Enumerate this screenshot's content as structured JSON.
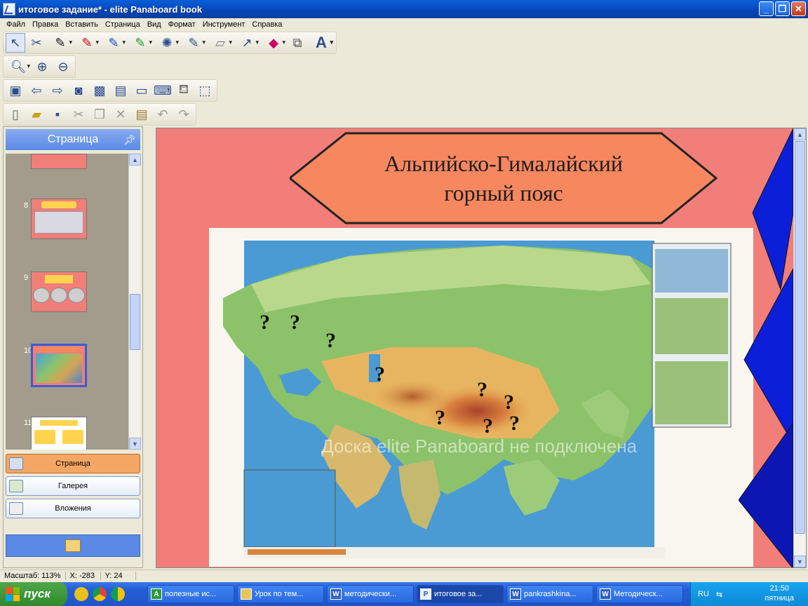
{
  "window": {
    "title": "итоговое задание* - elite Panaboard book"
  },
  "menu": [
    "Файл",
    "Правка",
    "Вставить",
    "Страница",
    "Вид",
    "Формат",
    "Инструмент",
    "Справка"
  ],
  "left_panel": {
    "header": "Страница",
    "pages": [
      {
        "number": "8"
      },
      {
        "number": "9"
      },
      {
        "number": "10"
      },
      {
        "number": "11"
      }
    ],
    "tabs": [
      {
        "label": "Страница",
        "active": true
      },
      {
        "label": "Галерея",
        "active": false
      },
      {
        "label": "Вложения",
        "active": false
      }
    ]
  },
  "slide": {
    "title_line1": "Альпийско-Гималайский",
    "title_line2": "горный пояс",
    "question_mark": "?",
    "watermark": "Доска elite Panaboard не подключена"
  },
  "status": {
    "zoom": "Масштаб: 113%",
    "x": "X: -283",
    "y": "Y: 24"
  },
  "taskbar": {
    "start": "пуск",
    "tasks": [
      {
        "label": "полезные ис...",
        "icon": "A"
      },
      {
        "label": "Урок по тем...",
        "icon": "folder"
      },
      {
        "label": "методически...",
        "icon": "W"
      },
      {
        "label": "итоговое за...",
        "icon": "P",
        "active": true
      },
      {
        "label": "pankrashkina...",
        "icon": "W"
      },
      {
        "label": "Методическ...",
        "icon": "W"
      }
    ],
    "lang": "RU",
    "time": "21:50",
    "day": "пятница"
  },
  "colors": {
    "slide_bg": "#f17e79",
    "hexagon_fill": "#f6875f",
    "side_shapes": "#0b1fd8",
    "active_tab": "#f4a665"
  }
}
